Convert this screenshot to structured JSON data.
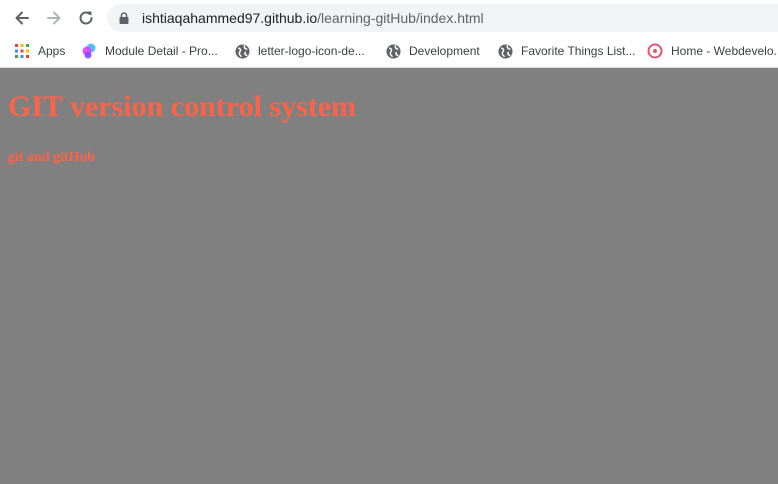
{
  "browser": {
    "url_host": "ishtiaqahammed97.github.io",
    "url_path": "/learning-gitHub/index.html",
    "bookmarks": [
      {
        "label": "Apps",
        "icon": "apps-grid-icon"
      },
      {
        "label": "Module Detail - Pro...",
        "icon": "colorful-logo-icon"
      },
      {
        "label": "letter-logo-icon-de...",
        "icon": "globe-icon"
      },
      {
        "label": "Development",
        "icon": "globe-icon"
      },
      {
        "label": "Favorite Things List...",
        "icon": "globe-icon"
      },
      {
        "label": "Home - Webdevelo...",
        "icon": "target-circle-icon"
      }
    ]
  },
  "page": {
    "background_color": "#808080",
    "heading_color": "#ff6347",
    "title": "GIT version control system",
    "subtitle": "git and gitHub"
  }
}
